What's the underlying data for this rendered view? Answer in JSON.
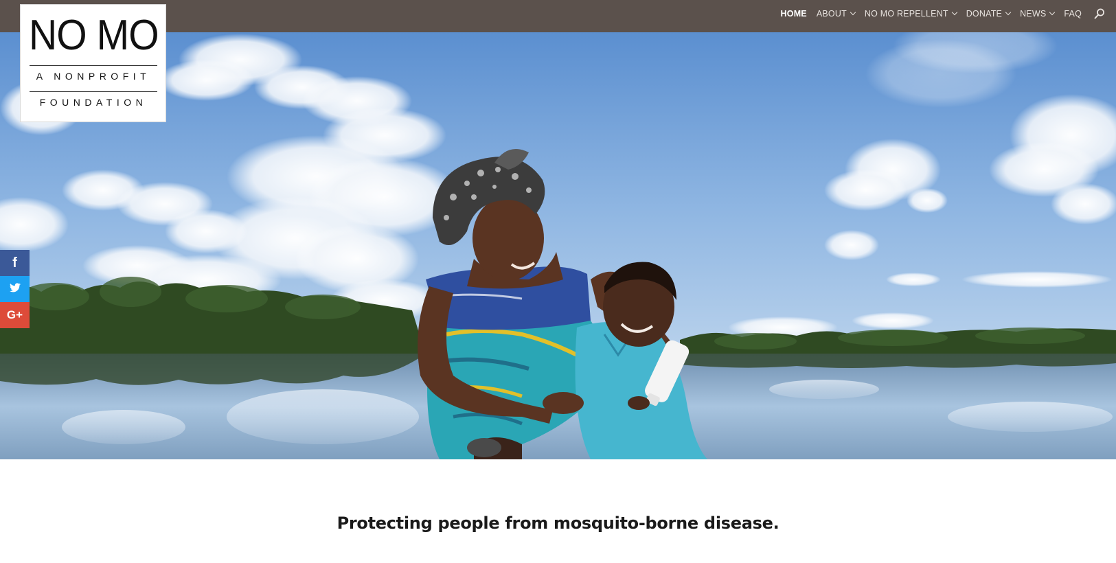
{
  "logo": {
    "title": "NO MO",
    "subtitle_line1": "A NONPROFIT",
    "subtitle_line2": "FOUNDATION"
  },
  "nav": {
    "items": [
      {
        "label": "HOME",
        "active": true,
        "has_dropdown": false
      },
      {
        "label": "ABOUT",
        "active": false,
        "has_dropdown": true
      },
      {
        "label": "NO MO REPELLENT",
        "active": false,
        "has_dropdown": true
      },
      {
        "label": "DONATE",
        "active": false,
        "has_dropdown": true
      },
      {
        "label": "NEWS",
        "active": false,
        "has_dropdown": true
      },
      {
        "label": "FAQ",
        "active": false,
        "has_dropdown": false
      }
    ],
    "search_icon": "search-icon"
  },
  "social": {
    "facebook": "f",
    "twitter": "t",
    "googleplus": "G+"
  },
  "hero": {
    "image": "mother-and-child-by-river-photo"
  },
  "tagline": "Protecting people from mosquito-borne disease.",
  "colors": {
    "topbar": "#5b514c",
    "facebook": "#3b5998",
    "twitter": "#1da1f2",
    "googleplus": "#dd4b39"
  }
}
